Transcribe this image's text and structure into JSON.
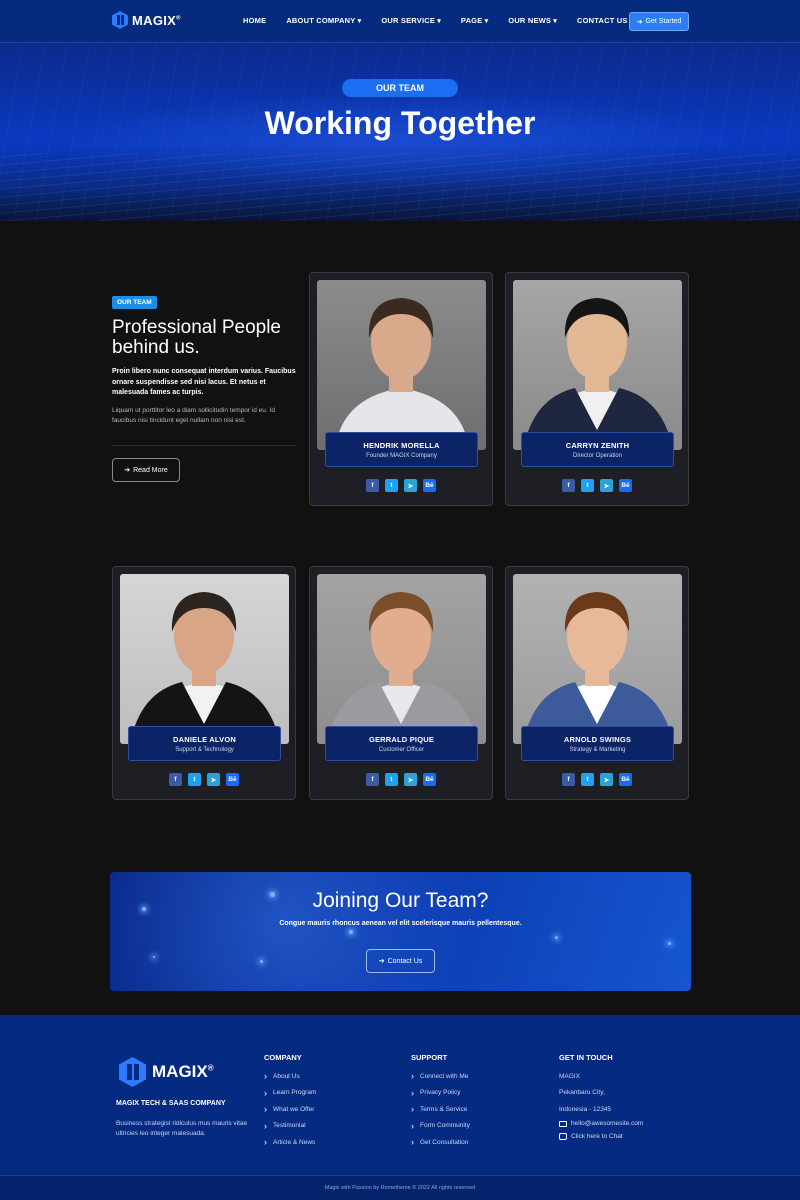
{
  "nav": {
    "logo": "MAGIX",
    "logo_mark": "®",
    "items": [
      {
        "label": "HOME",
        "dropdown": false
      },
      {
        "label": "ABOUT COMPANY",
        "dropdown": true
      },
      {
        "label": "OUR SERVICE",
        "dropdown": true
      },
      {
        "label": "PAGE",
        "dropdown": true
      },
      {
        "label": "OUR NEWS",
        "dropdown": true
      },
      {
        "label": "CONTACT US",
        "dropdown": false
      }
    ],
    "cta": "Get Started"
  },
  "hero": {
    "pill": "OUR TEAM",
    "title": "Working Together"
  },
  "intro": {
    "tag": "OUR TEAM",
    "heading": "Professional People behind us.",
    "bold": "Proin libero nunc consequat interdum varius. Faucibus ornare suspendisse sed nisi lacus. Et netus et malesuada fames ac turpis.",
    "body": "Liquam ut porttitor leo a diam sollicitudin tempor id eu. Id faucibus nisi tincidunt eget nullam non nisi est.",
    "button": "Read More"
  },
  "team": [
    {
      "name": "HENDRIK MORELLA",
      "role": "Founder MAGIX Company"
    },
    {
      "name": "CARRYN ZENITH",
      "role": "Director Operation"
    },
    {
      "name": "DANIELE ALVON",
      "role": "Support & Technology"
    },
    {
      "name": "GERRALD PIQUE",
      "role": "Customer Officer"
    },
    {
      "name": "ARNOLD SWINGS",
      "role": "Strategy & Marketing"
    }
  ],
  "social_icons": [
    "facebook-icon",
    "twitter-icon",
    "telegram-icon",
    "behance-icon"
  ],
  "join": {
    "title": "Joining Our Team?",
    "subtitle": "Congue mauris rhoncus aenean vel elit scelerisque mauris pellentesque.",
    "button": "Contact Us"
  },
  "footer": {
    "logo": "MAGIX",
    "logo_mark": "®",
    "company": "MAGIX TECH & SAAS COMPANY",
    "description": "Business strategist ridiculus mus mauris vitae ultricies leo integer malesuada.",
    "company_col": {
      "title": "COMPANY",
      "links": [
        "About Us",
        "Learn Program",
        "What we Offer",
        "Testimonial",
        "Article & News"
      ]
    },
    "support_col": {
      "title": "SUPPORT",
      "links": [
        "Connect with Me",
        "Privacy Policy",
        "Terms & Service",
        "Form Community",
        "Get Consultation"
      ]
    },
    "contact_col": {
      "title": "GET IN TOUCH",
      "lines": [
        "MAGIX",
        "Pekanbaru City,",
        "Indonesia - 12345"
      ],
      "email": "hello@awesomesite.com",
      "chat": "Click here to Chat"
    },
    "copyright": "Magix with Passion by Rometheme © 2022 All rights reserved"
  },
  "colors": {
    "accent": "#2d7ef3",
    "nav_bg": "#062a7d",
    "page_bg": "#111112",
    "card_bg": "#1e1f24",
    "nameplate": "#0c2466"
  }
}
